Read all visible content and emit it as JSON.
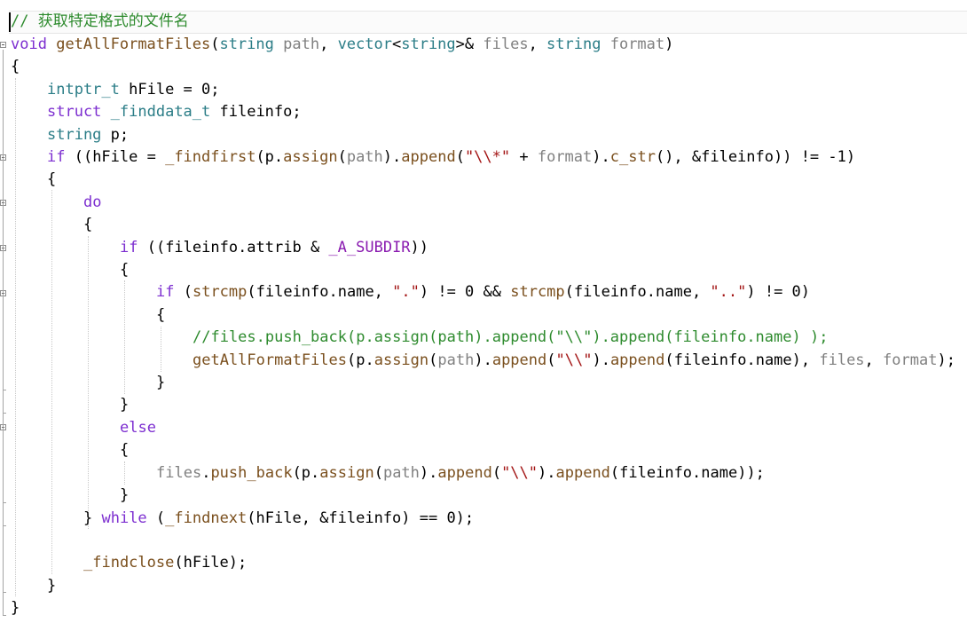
{
  "editor": {
    "lines": [
      {
        "indent": 0,
        "tokens": [
          {
            "t": "// 获取特定格式的文件名",
            "c": "cm"
          }
        ]
      },
      {
        "indent": 0,
        "tokens": [
          {
            "t": "void",
            "c": "kw"
          },
          {
            "t": " "
          },
          {
            "t": "getAllFormatFiles",
            "c": "fn"
          },
          {
            "t": "("
          },
          {
            "t": "string",
            "c": "ty"
          },
          {
            "t": " "
          },
          {
            "t": "path",
            "c": "pm"
          },
          {
            "t": ", "
          },
          {
            "t": "vector",
            "c": "ty"
          },
          {
            "t": "<"
          },
          {
            "t": "string",
            "c": "ty"
          },
          {
            "t": ">& "
          },
          {
            "t": "files",
            "c": "pm"
          },
          {
            "t": ", "
          },
          {
            "t": "string",
            "c": "ty"
          },
          {
            "t": " "
          },
          {
            "t": "format",
            "c": "pm"
          },
          {
            "t": ")"
          }
        ]
      },
      {
        "indent": 0,
        "tokens": [
          {
            "t": "{"
          }
        ]
      },
      {
        "indent": 1,
        "tokens": [
          {
            "t": "intptr_t",
            "c": "ty"
          },
          {
            "t": " hFile = 0;"
          }
        ]
      },
      {
        "indent": 1,
        "tokens": [
          {
            "t": "struct",
            "c": "kw"
          },
          {
            "t": " "
          },
          {
            "t": "_finddata_t",
            "c": "ty"
          },
          {
            "t": " fileinfo;"
          }
        ]
      },
      {
        "indent": 1,
        "tokens": [
          {
            "t": "string",
            "c": "ty"
          },
          {
            "t": " p;"
          }
        ]
      },
      {
        "indent": 1,
        "tokens": [
          {
            "t": "if",
            "c": "kw"
          },
          {
            "t": " ((hFile = "
          },
          {
            "t": "_findfirst",
            "c": "fn"
          },
          {
            "t": "(p."
          },
          {
            "t": "assign",
            "c": "fn"
          },
          {
            "t": "("
          },
          {
            "t": "path",
            "c": "pm"
          },
          {
            "t": ")."
          },
          {
            "t": "append",
            "c": "fn"
          },
          {
            "t": "("
          },
          {
            "t": "\"\\\\*\"",
            "c": "st"
          },
          {
            "t": " + "
          },
          {
            "t": "format",
            "c": "pm"
          },
          {
            "t": ")."
          },
          {
            "t": "c_str",
            "c": "fn"
          },
          {
            "t": "(), &fileinfo)) != -1)"
          }
        ]
      },
      {
        "indent": 1,
        "tokens": [
          {
            "t": "{"
          }
        ]
      },
      {
        "indent": 2,
        "tokens": [
          {
            "t": "do",
            "c": "kw"
          }
        ]
      },
      {
        "indent": 2,
        "tokens": [
          {
            "t": "{"
          }
        ]
      },
      {
        "indent": 3,
        "tokens": [
          {
            "t": "if",
            "c": "kw"
          },
          {
            "t": " ((fileinfo.attrib & "
          },
          {
            "t": "_A_SUBDIR",
            "c": "mc"
          },
          {
            "t": "))"
          }
        ]
      },
      {
        "indent": 3,
        "tokens": [
          {
            "t": "{"
          }
        ]
      },
      {
        "indent": 4,
        "tokens": [
          {
            "t": "if",
            "c": "kw"
          },
          {
            "t": " ("
          },
          {
            "t": "strcmp",
            "c": "fn"
          },
          {
            "t": "(fileinfo.name, "
          },
          {
            "t": "\".\"",
            "c": "st"
          },
          {
            "t": ") != 0 && "
          },
          {
            "t": "strcmp",
            "c": "fn"
          },
          {
            "t": "(fileinfo.name, "
          },
          {
            "t": "\"..\"",
            "c": "st"
          },
          {
            "t": ") != 0)"
          }
        ]
      },
      {
        "indent": 4,
        "tokens": [
          {
            "t": "{"
          }
        ]
      },
      {
        "indent": 5,
        "tokens": [
          {
            "t": "//files.push_back(p.assign(path).append(\"\\\\\").append(fileinfo.name) );",
            "c": "cm"
          }
        ]
      },
      {
        "indent": 5,
        "tokens": [
          {
            "t": "getAllFormatFiles",
            "c": "fn"
          },
          {
            "t": "(p."
          },
          {
            "t": "assign",
            "c": "fn"
          },
          {
            "t": "("
          },
          {
            "t": "path",
            "c": "pm"
          },
          {
            "t": ")."
          },
          {
            "t": "append",
            "c": "fn"
          },
          {
            "t": "("
          },
          {
            "t": "\"\\\\\"",
            "c": "st"
          },
          {
            "t": ")."
          },
          {
            "t": "append",
            "c": "fn"
          },
          {
            "t": "(fileinfo.name), "
          },
          {
            "t": "files",
            "c": "pm"
          },
          {
            "t": ", "
          },
          {
            "t": "format",
            "c": "pm"
          },
          {
            "t": ");"
          }
        ]
      },
      {
        "indent": 4,
        "tokens": [
          {
            "t": "}"
          }
        ]
      },
      {
        "indent": 3,
        "tokens": [
          {
            "t": "}"
          }
        ]
      },
      {
        "indent": 3,
        "tokens": [
          {
            "t": "else",
            "c": "kw"
          }
        ]
      },
      {
        "indent": 3,
        "tokens": [
          {
            "t": "{"
          }
        ]
      },
      {
        "indent": 4,
        "tokens": [
          {
            "t": "files",
            "c": "pm"
          },
          {
            "t": "."
          },
          {
            "t": "push_back",
            "c": "fn"
          },
          {
            "t": "(p."
          },
          {
            "t": "assign",
            "c": "fn"
          },
          {
            "t": "("
          },
          {
            "t": "path",
            "c": "pm"
          },
          {
            "t": ")."
          },
          {
            "t": "append",
            "c": "fn"
          },
          {
            "t": "("
          },
          {
            "t": "\"\\\\\"",
            "c": "st"
          },
          {
            "t": ")."
          },
          {
            "t": "append",
            "c": "fn"
          },
          {
            "t": "(fileinfo.name));"
          }
        ]
      },
      {
        "indent": 3,
        "tokens": [
          {
            "t": "}"
          }
        ]
      },
      {
        "indent": 2,
        "tokens": [
          {
            "t": "} "
          },
          {
            "t": "while",
            "c": "kw"
          },
          {
            "t": " ("
          },
          {
            "t": "_findnext",
            "c": "fn"
          },
          {
            "t": "(hFile, &fileinfo) == 0);"
          }
        ]
      },
      {
        "indent": 2,
        "tokens": []
      },
      {
        "indent": 2,
        "tokens": [
          {
            "t": "_findclose",
            "c": "fn"
          },
          {
            "t": "(hFile);"
          }
        ]
      },
      {
        "indent": 1,
        "tokens": [
          {
            "t": "}"
          }
        ]
      },
      {
        "indent": 0,
        "tokens": [
          {
            "t": "}"
          }
        ]
      }
    ]
  }
}
